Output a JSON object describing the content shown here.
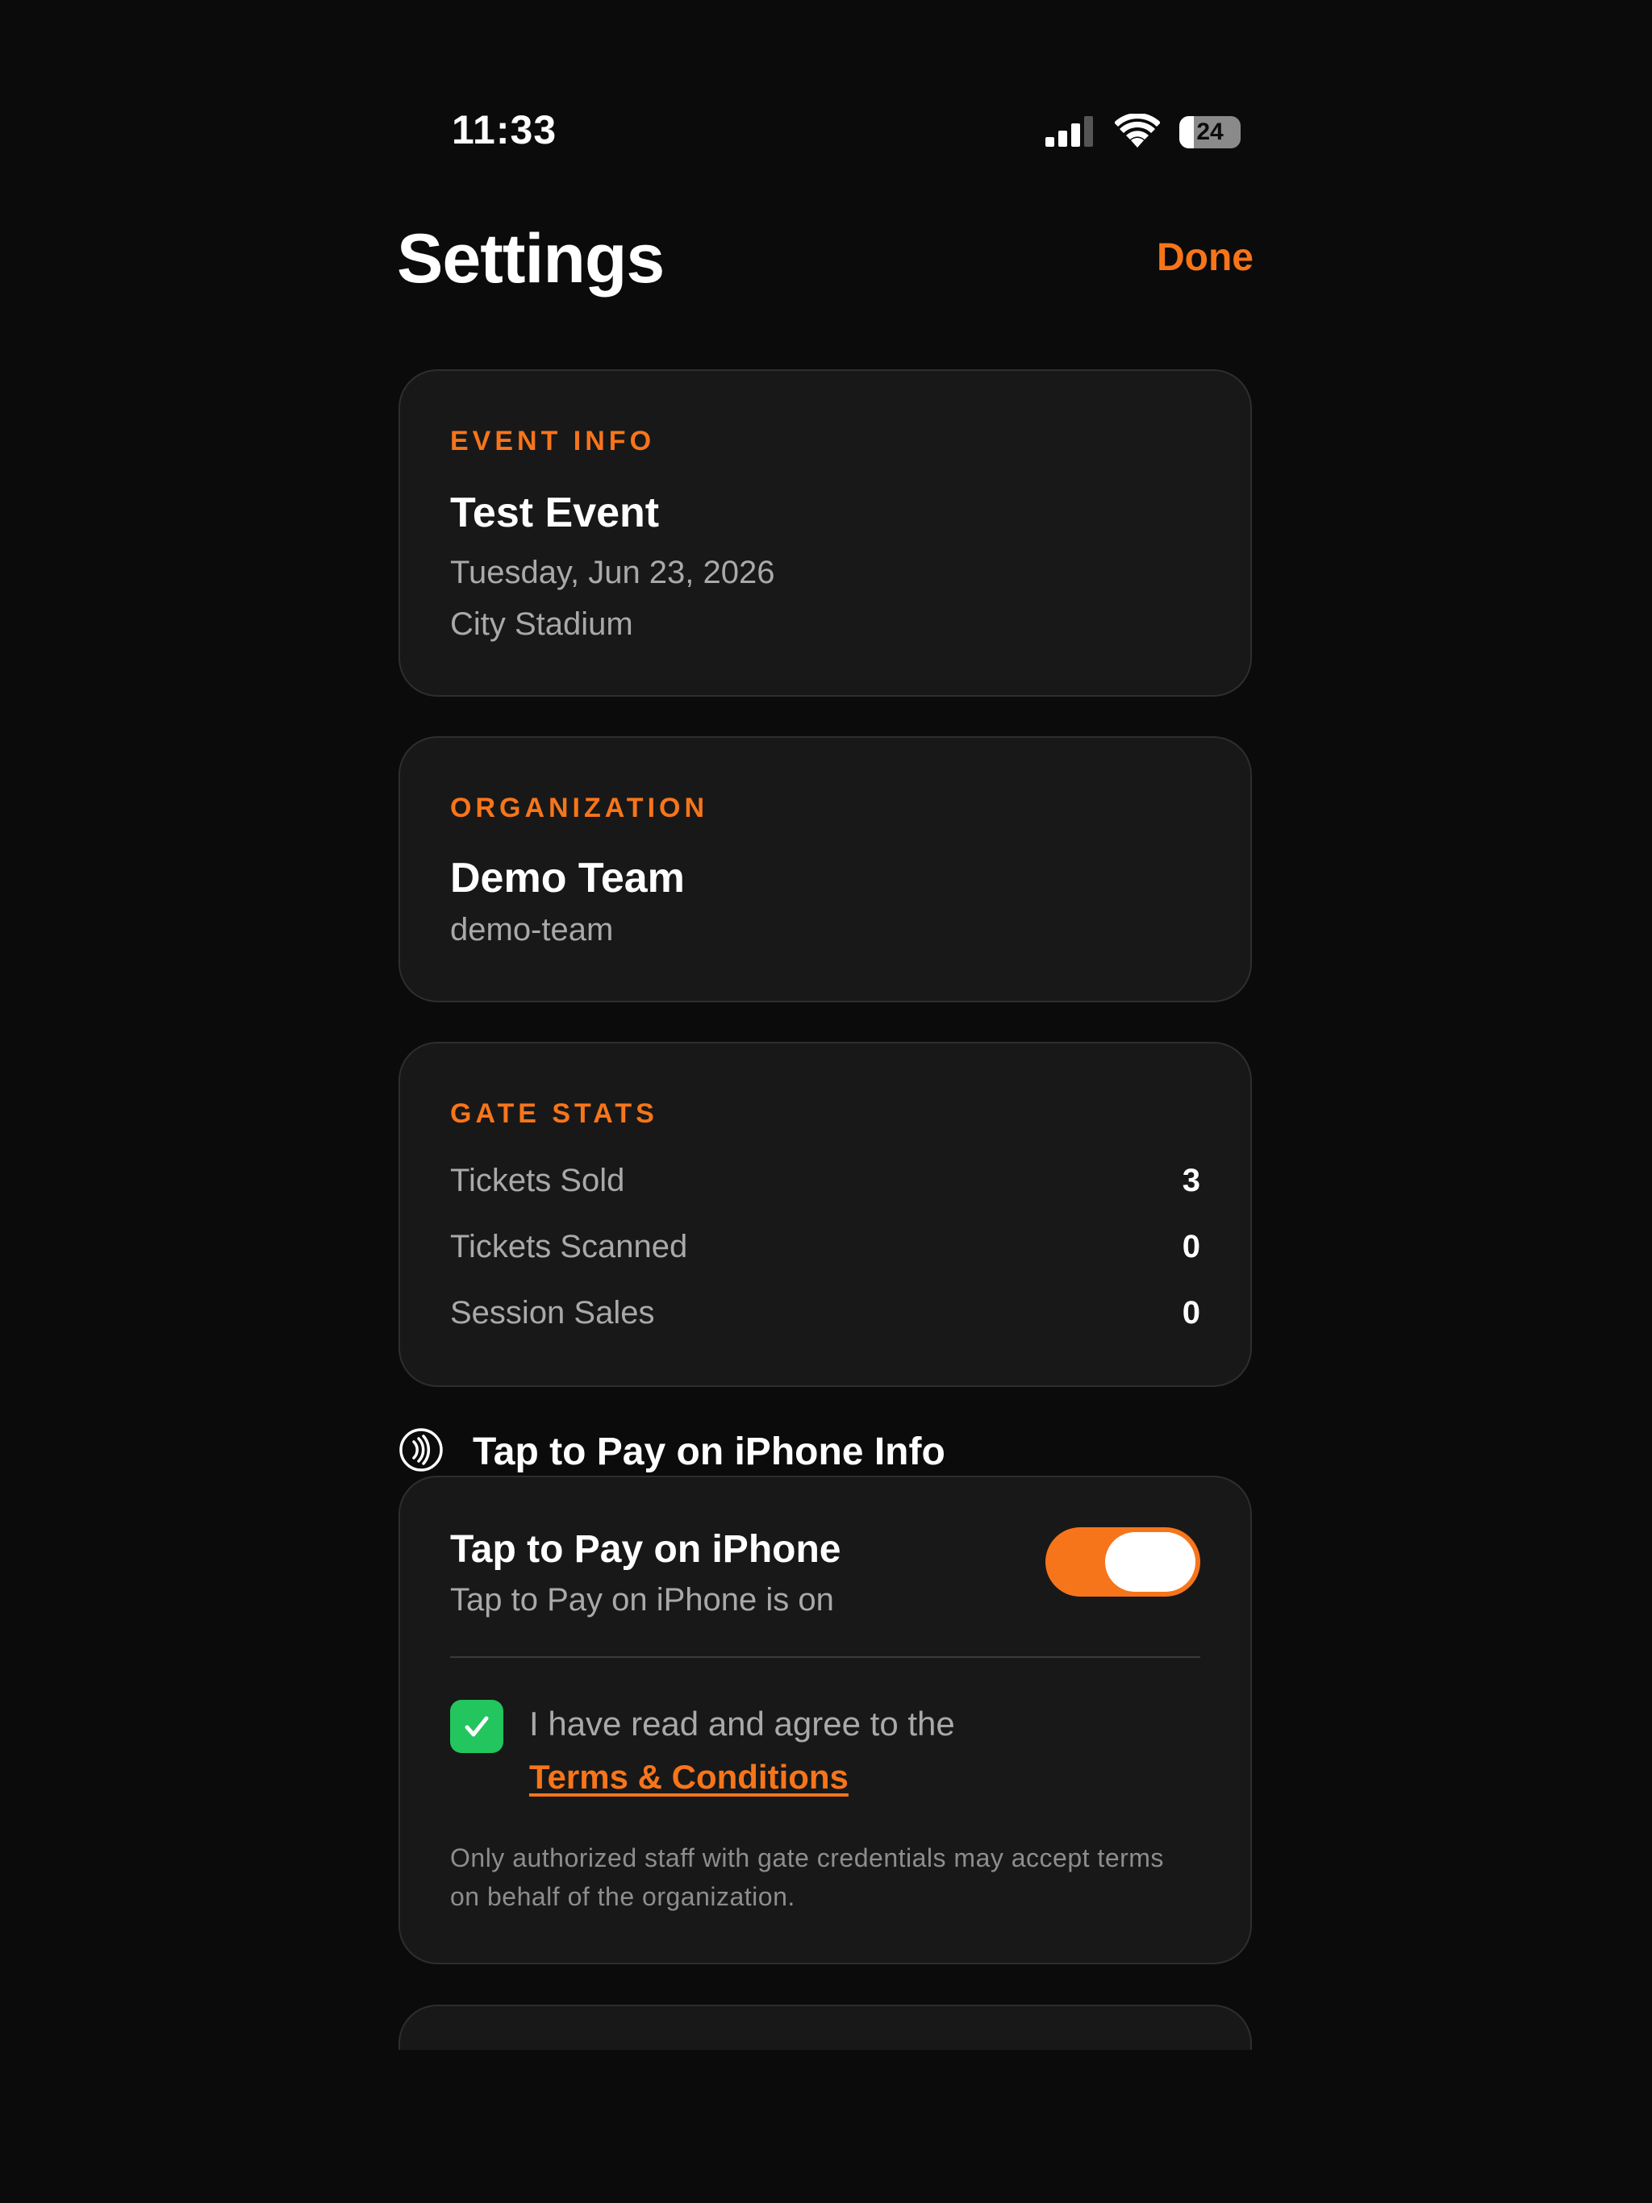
{
  "status_bar": {
    "time": "11:33",
    "battery_percent": "24",
    "icons": [
      "cellular-signal-icon",
      "wifi-icon",
      "battery-icon"
    ]
  },
  "header": {
    "title": "Settings",
    "done_label": "Done"
  },
  "event_info": {
    "label": "EVENT INFO",
    "name": "Test Event",
    "date": "Tuesday, Jun 23, 2026",
    "venue": "City Stadium"
  },
  "organization": {
    "label": "ORGANIZATION",
    "name": "Demo Team",
    "slug": "demo-team"
  },
  "gate_stats": {
    "label": "GATE STATS",
    "rows": [
      {
        "label": "Tickets Sold",
        "value": "3"
      },
      {
        "label": "Tickets Scanned",
        "value": "0"
      },
      {
        "label": "Session Sales",
        "value": "0"
      }
    ]
  },
  "tap_to_pay": {
    "section_title": "Tap to Pay on iPhone Info",
    "section_icon": "contactless-icon",
    "title": "Tap to Pay on iPhone",
    "status": "Tap to Pay on iPhone is on",
    "toggle_on": true,
    "checkbox_checked": true,
    "agree_text": "I have read and agree to the",
    "terms_link": "Terms & Conditions",
    "note": "Only authorized staff with gate credentials may accept terms on behalf of the organization."
  },
  "colors": {
    "background": "#0b0b0b",
    "card": "#181818",
    "accent": "#f7751a",
    "success": "#22c55e",
    "secondary_text": "#a9a9a9"
  }
}
